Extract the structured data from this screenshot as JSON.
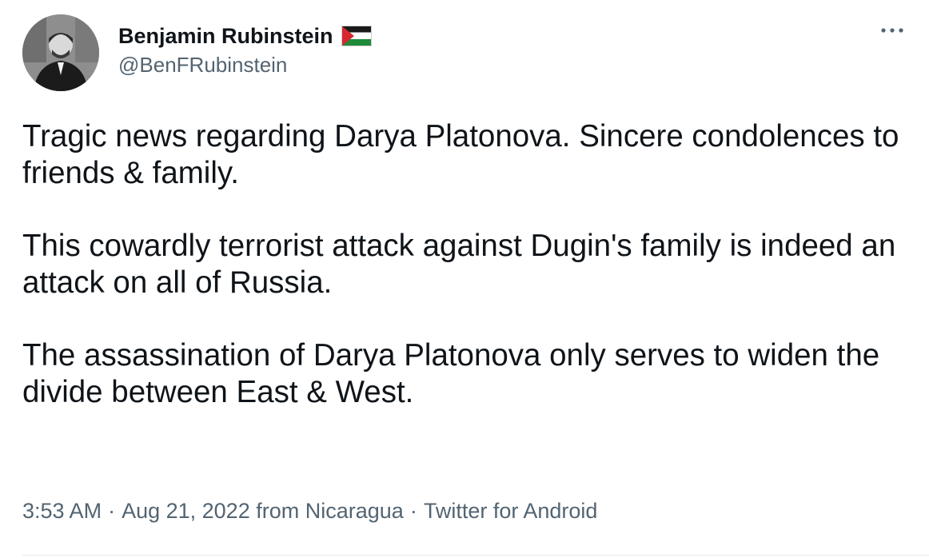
{
  "author": {
    "display_name": "Benjamin Rubinstein",
    "handle": "@BenFRubinstein",
    "flag_icon": "palestine-flag-icon"
  },
  "tweet": {
    "paragraphs": [
      "Tragic news regarding Darya Platonova. Sincere condolences to friends & family.",
      "This cowardly terrorist attack against Dugin's family is indeed an attack on all of Russia.",
      "The assassination of Darya Platonova only serves to widen the divide between East & West."
    ]
  },
  "meta": {
    "time": "3:53 AM",
    "date": "Aug 21, 2022",
    "location": "from Nicaragua",
    "client": "Twitter for Android",
    "separator": "·"
  },
  "colors": {
    "text_primary": "#0f1419",
    "text_secondary": "#536471",
    "divider": "#e6e9eb"
  }
}
